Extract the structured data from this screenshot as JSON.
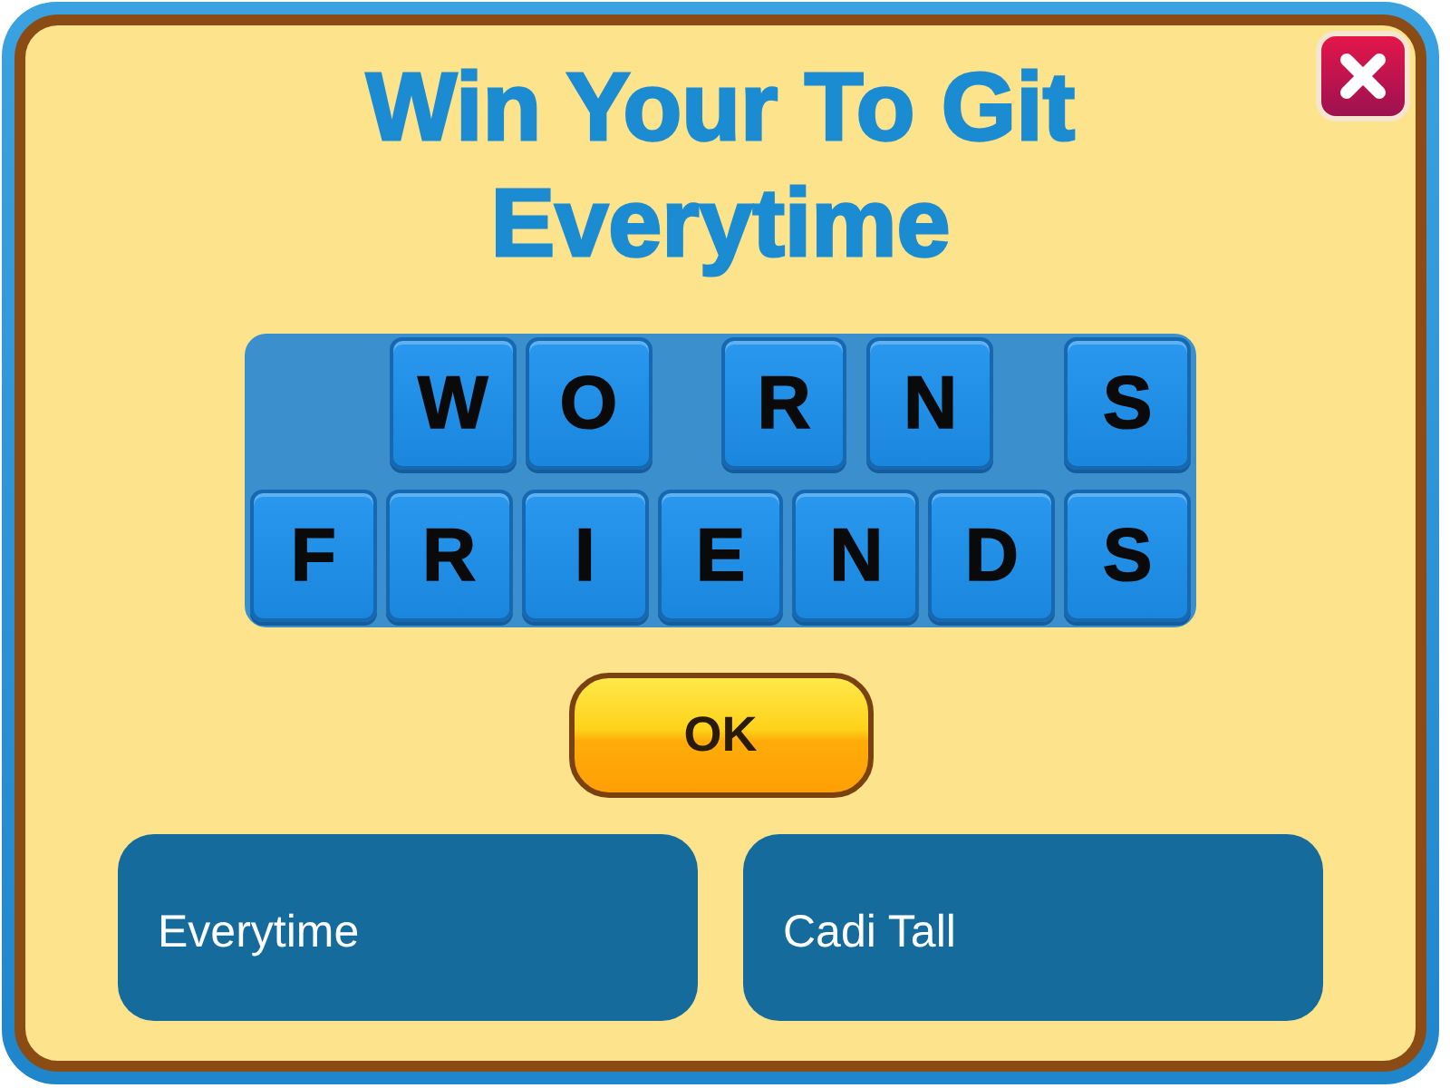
{
  "title": "Win Your To Git Everytime",
  "board": {
    "rows": [
      {
        "tiles": [
          "W",
          "O",
          "R",
          "N",
          "S"
        ]
      },
      {
        "tiles": [
          "F",
          "R",
          "I",
          "E",
          "N",
          "D",
          "S"
        ]
      }
    ]
  },
  "ok_button": {
    "label": "OK"
  },
  "answers": [
    {
      "label": "Everytime"
    },
    {
      "label": "Cadi Tall"
    }
  ]
}
